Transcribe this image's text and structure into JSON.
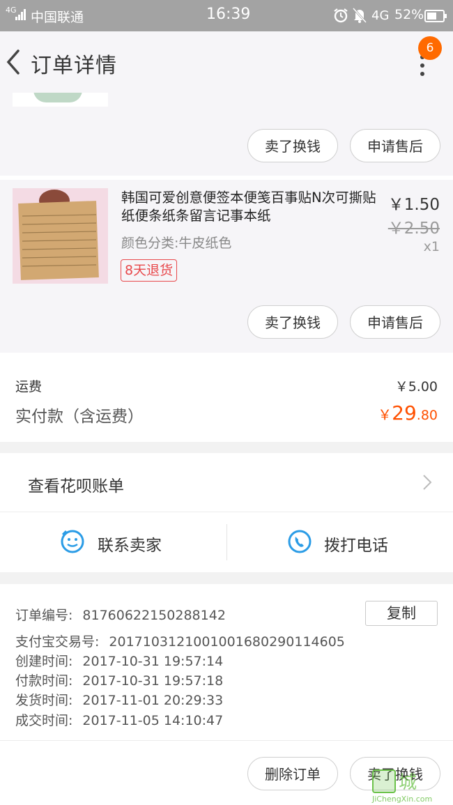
{
  "status_bar": {
    "network": "4G",
    "carrier": "中国联通",
    "time": "16:39",
    "net_type": "4G",
    "battery": "52%"
  },
  "header": {
    "title": "订单详情",
    "badge_count": "6"
  },
  "first_item": {
    "btn_sell": "卖了换钱",
    "btn_after_sale": "申请售后"
  },
  "second_item": {
    "name": "韩国可爱创意便签本便笺百事贴N次可撕贴纸便条纸条留言记事本纸",
    "sku": "颜色分类:牛皮纸色",
    "return_tag": "8天退货",
    "price": "￥1.50",
    "original_price": "￥2.50",
    "qty": "x1",
    "btn_sell": "卖了换钱",
    "btn_after_sale": "申请售后"
  },
  "totals": {
    "shipping_label": "运费",
    "shipping_value": "￥5.00",
    "paid_label": "实付款（含运费）",
    "paid_currency": "￥",
    "paid_int": "29",
    "paid_dec": ".80"
  },
  "huabei": {
    "label": "查看花呗账单"
  },
  "contact": {
    "seller_label": "联系卖家",
    "phone_label": "拨打电话"
  },
  "order_info": {
    "order_no_label": "订单编号:",
    "order_no": "81760622150288142",
    "copy_label": "复制",
    "alipay_label": "支付宝交易号:",
    "alipay_no": "2017103121001001680290114605",
    "created_label": "创建时间:",
    "created": "2017-10-31 19:57:14",
    "paid_label": "付款时间:",
    "paid": "2017-10-31 19:57:18",
    "shipped_label": "发货时间:",
    "shipped": "2017-11-01 20:29:33",
    "done_label": "成交时间:",
    "done": "2017-11-05 14:10:47"
  },
  "footer": {
    "delete_label": "删除订单",
    "sell_label": "卖了换钱"
  },
  "watermark": {
    "title": "城",
    "url": "JiChengXin.com"
  },
  "colors": {
    "accent": "#ff5000",
    "badge": "#ff6a00",
    "tag_red": "#e8484b",
    "icon_blue": "#2b9ce6"
  }
}
